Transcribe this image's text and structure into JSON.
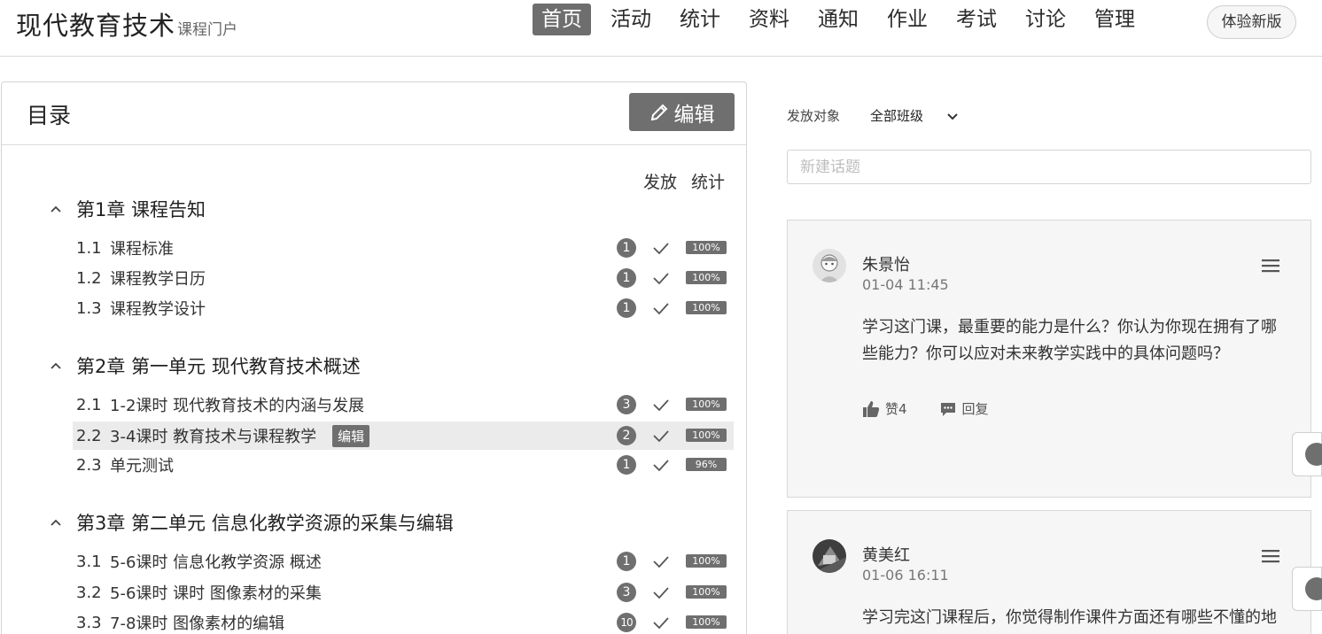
{
  "header": {
    "title": "现代教育技术",
    "subtitle": "课程门户",
    "nav": [
      "首页",
      "活动",
      "统计",
      "资料",
      "通知",
      "作业",
      "考试",
      "讨论",
      "管理"
    ],
    "active_nav": "首页",
    "new_version_label": "体验新版"
  },
  "catalog": {
    "title": "目录",
    "edit_label": "编辑",
    "col_release": "发放",
    "col_stats": "统计",
    "inline_edit_label": "编辑",
    "chapters": [
      {
        "title": "第1章 课程告知",
        "lessons": [
          {
            "num": "1.1",
            "title": "课程标准",
            "count": "1",
            "pct": "100%"
          },
          {
            "num": "1.2",
            "title": "课程教学日历",
            "count": "1",
            "pct": "100%"
          },
          {
            "num": "1.3",
            "title": "课程教学设计",
            "count": "1",
            "pct": "100%"
          }
        ]
      },
      {
        "title": "第2章 第一单元 现代教育技术概述",
        "lessons": [
          {
            "num": "2.1",
            "title": "1-2课时 现代教育技术的内涵与发展",
            "count": "3",
            "pct": "100%"
          },
          {
            "num": "2.2",
            "title": "3-4课时 教育技术与课程教学",
            "count": "2",
            "pct": "100%",
            "highlighted": true
          },
          {
            "num": "2.3",
            "title": "单元测试",
            "count": "1",
            "pct": "96%"
          }
        ]
      },
      {
        "title": "第3章 第二单元 信息化教学资源的采集与编辑",
        "lessons": [
          {
            "num": "3.1",
            "title": "5-6课时 信息化教学资源 概述",
            "count": "1",
            "pct": "100%"
          },
          {
            "num": "3.2",
            "title": "5-6课时 课时 图像素材的采集",
            "count": "3",
            "pct": "100%"
          },
          {
            "num": "3.3",
            "title": "7-8课时 图像素材的编辑",
            "count": "10",
            "pct": "100%"
          }
        ]
      }
    ]
  },
  "discussion": {
    "target_label": "发放对象",
    "target_value": "全部班级",
    "new_topic_placeholder": "新建话题",
    "posts": [
      {
        "author": "朱景怡",
        "time": "01-04 11:45",
        "body": "学习这门课，最重要的能力是什么？你认为你现在拥有了哪些能力？你可以应对未来教学实践中的具体问题吗？",
        "like_label": "赞4",
        "reply_label": "回复"
      },
      {
        "author": "黄美红",
        "time": "01-06 16:11",
        "body": "学习完这门课程后，你觉得制作课件方面还有哪些不懂的地",
        "like_label": "",
        "reply_label": ""
      }
    ]
  }
}
